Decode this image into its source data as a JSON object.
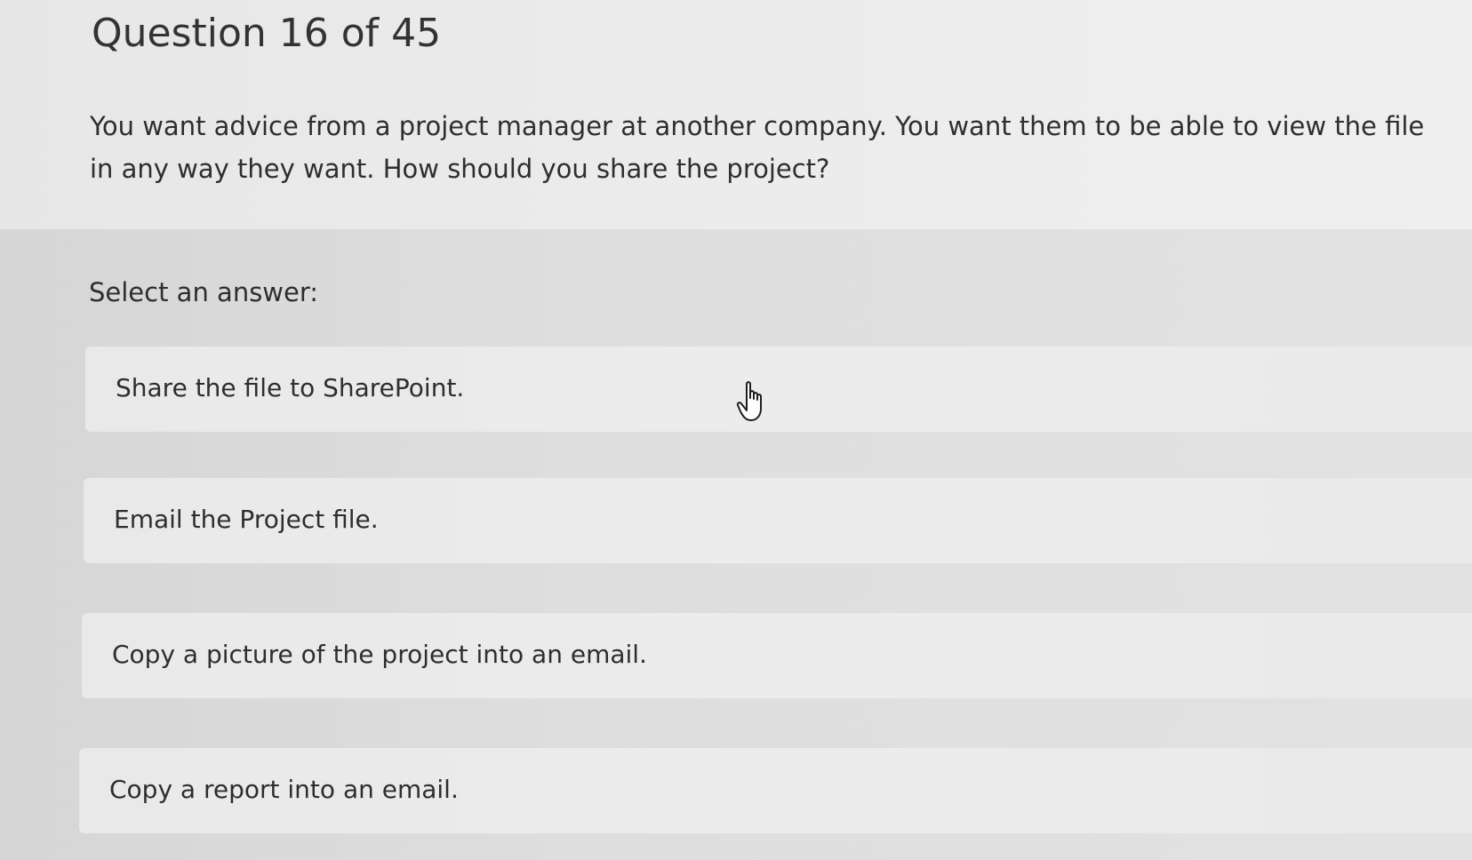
{
  "question": {
    "number_label": "Question 16 of 45",
    "text": "You want advice from a project manager at another company. You want them to be able to view the file in any way they want. How should you share the project?"
  },
  "answers": {
    "prompt": "Select an answer:",
    "options": [
      {
        "label": "Share the file to SharePoint."
      },
      {
        "label": "Email the Project file."
      },
      {
        "label": "Copy a picture of the project into an email."
      },
      {
        "label": "Copy a report into an email."
      }
    ]
  },
  "cursor": {
    "icon": "hand-pointer-icon"
  }
}
